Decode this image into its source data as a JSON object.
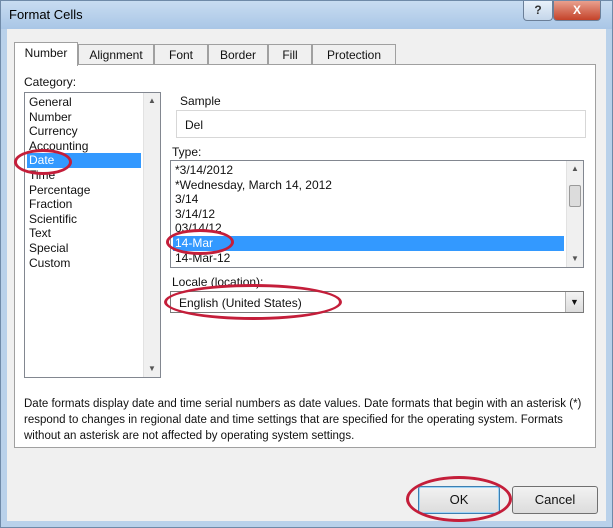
{
  "window": {
    "title": "Format Cells",
    "help_label": "?",
    "close_label": "X"
  },
  "tabs": [
    {
      "label": "Number",
      "active": true
    },
    {
      "label": "Alignment"
    },
    {
      "label": "Font"
    },
    {
      "label": "Border"
    },
    {
      "label": "Fill"
    },
    {
      "label": "Protection"
    }
  ],
  "category": {
    "label": "Category:",
    "items": [
      "General",
      "Number",
      "Currency",
      "Accounting",
      "Date",
      "Time",
      "Percentage",
      "Fraction",
      "Scientific",
      "Text",
      "Special",
      "Custom"
    ],
    "selected": "Date"
  },
  "sample": {
    "label": "Sample",
    "value": "Del"
  },
  "type": {
    "label": "Type:",
    "items": [
      "*3/14/2012",
      "*Wednesday, March 14, 2012",
      "3/14",
      "3/14/12",
      "03/14/12",
      "14-Mar",
      "14-Mar-12"
    ],
    "selected": "14-Mar"
  },
  "locale": {
    "label": "Locale (location):",
    "value": "English (United States)"
  },
  "description": "Date formats display date and time serial numbers as date values.  Date formats that begin with an asterisk (*) respond to changes in regional date and time settings that are specified for the operating system. Formats without an asterisk are not affected by operating system settings.",
  "buttons": {
    "ok": "OK",
    "cancel": "Cancel"
  },
  "annotation_color": "#c41e3a"
}
